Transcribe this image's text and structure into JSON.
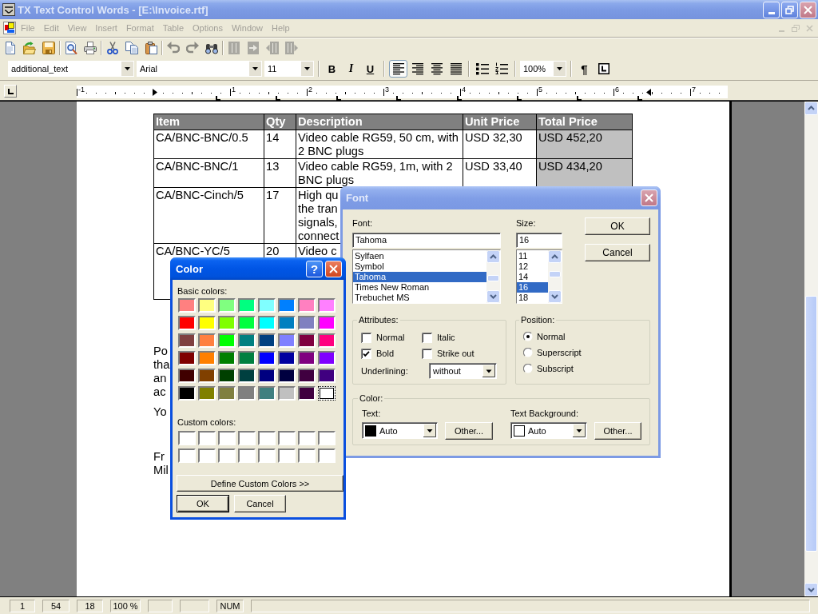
{
  "window": {
    "title": "TX Text Control Words - [E:\\Invoice.rtf]"
  },
  "menu": [
    {
      "label": "File",
      "disabled": true
    },
    {
      "label": "Edit",
      "disabled": true
    },
    {
      "label": "View",
      "disabled": true
    },
    {
      "label": "Insert",
      "disabled": true
    },
    {
      "label": "Format",
      "disabled": true
    },
    {
      "label": "Table",
      "disabled": true
    },
    {
      "label": "Options",
      "disabled": true
    },
    {
      "label": "Window",
      "disabled": true
    },
    {
      "label": "Help",
      "disabled": true
    }
  ],
  "toolbar": [
    {
      "kind": "new",
      "disabled": false
    },
    {
      "kind": "open",
      "disabled": false
    },
    {
      "kind": "save",
      "disabled": false
    },
    {
      "kind": "separator"
    },
    {
      "kind": "preview",
      "disabled": false
    },
    {
      "kind": "print",
      "disabled": false
    },
    {
      "kind": "separator"
    },
    {
      "kind": "cut",
      "disabled": false
    },
    {
      "kind": "copy",
      "disabled": false
    },
    {
      "kind": "paste",
      "disabled": false
    },
    {
      "kind": "separator"
    },
    {
      "kind": "undo",
      "disabled": true
    },
    {
      "kind": "redo",
      "disabled": true
    },
    {
      "kind": "find",
      "disabled": false
    },
    {
      "kind": "separator"
    },
    {
      "kind": "table-cells",
      "disabled": true
    },
    {
      "kind": "table-merge",
      "disabled": true
    },
    {
      "kind": "table-left",
      "disabled": true
    },
    {
      "kind": "table-right",
      "disabled": true
    }
  ],
  "format_bar": {
    "style": "additional_text",
    "font": "Arial",
    "size": "11",
    "text_styles": [
      {
        "kind": "bold",
        "label": "B"
      },
      {
        "kind": "italic",
        "label": "I"
      },
      {
        "kind": "underline",
        "label": "U"
      }
    ],
    "alignments": [
      {
        "kind": "left",
        "selected": true
      },
      {
        "kind": "right",
        "selected": false
      },
      {
        "kind": "center",
        "selected": false
      },
      {
        "kind": "justify",
        "selected": false
      }
    ],
    "lists": [
      {
        "kind": "bullets"
      },
      {
        "kind": "numbering"
      }
    ],
    "zoom": "100%",
    "pilcrow": "¶"
  },
  "ruler": {
    "numbers": [
      "-1",
      "1",
      "2",
      "3",
      "4",
      "5",
      "6",
      "7"
    ]
  },
  "table": {
    "columns": [
      {
        "label": "Item",
        "shaded": false
      },
      {
        "label": "Qty",
        "shaded": false
      },
      {
        "label": "Description",
        "shaded": false
      },
      {
        "label": "Unit Price",
        "shaded": false
      },
      {
        "label": "Total Price",
        "shaded": true
      }
    ],
    "rows": [
      {
        "cells": [
          "CA/BNC-BNC/0.5",
          "14",
          "Video cable RG59, 50 cm, with 2 BNC plugs",
          "USD 32,30",
          "USD 452,20"
        ]
      },
      {
        "cells": [
          "CA/BNC-BNC/1",
          "13",
          "Video cable RG59, 1m, with 2 BNC plugs",
          "USD 33,40",
          "USD 434,20"
        ]
      },
      {
        "cells": [
          "CA/BNC-Cinch/5",
          "17",
          "High qu\nthe tran\nsignals,\nconnect"
        ]
      },
      {
        "cells": [
          "CA/BNC-YC/5",
          "20",
          "Video c"
        ]
      }
    ]
  },
  "paragraphs": [
    "Po\ntha\nan\nac",
    "Yo",
    "Fr\nMil"
  ],
  "color_dialog": {
    "title": "Color",
    "help_button": "?",
    "basic_label": "Basic colors:",
    "basic_colors": [
      {
        "color": "#ff8080",
        "selected": false
      },
      {
        "color": "#ffff80",
        "selected": false
      },
      {
        "color": "#80ff80",
        "selected": false
      },
      {
        "color": "#00ff80",
        "selected": false
      },
      {
        "color": "#80ffff",
        "selected": false
      },
      {
        "color": "#0080ff",
        "selected": false
      },
      {
        "color": "#ff80c0",
        "selected": false
      },
      {
        "color": "#ff80ff",
        "selected": false
      },
      {
        "color": "#ff0000",
        "selected": false
      },
      {
        "color": "#ffff00",
        "selected": false
      },
      {
        "color": "#80ff00",
        "selected": false
      },
      {
        "color": "#00ff40",
        "selected": false
      },
      {
        "color": "#00ffff",
        "selected": false
      },
      {
        "color": "#0080c0",
        "selected": false
      },
      {
        "color": "#8080c0",
        "selected": false
      },
      {
        "color": "#ff00ff",
        "selected": false
      },
      {
        "color": "#804040",
        "selected": false
      },
      {
        "color": "#ff8040",
        "selected": false
      },
      {
        "color": "#00ff00",
        "selected": false
      },
      {
        "color": "#008080",
        "selected": false
      },
      {
        "color": "#004080",
        "selected": false
      },
      {
        "color": "#8080ff",
        "selected": false
      },
      {
        "color": "#800040",
        "selected": false
      },
      {
        "color": "#ff0080",
        "selected": false
      },
      {
        "color": "#800000",
        "selected": false
      },
      {
        "color": "#ff8000",
        "selected": false
      },
      {
        "color": "#008000",
        "selected": false
      },
      {
        "color": "#008040",
        "selected": false
      },
      {
        "color": "#0000ff",
        "selected": false
      },
      {
        "color": "#0000a0",
        "selected": false
      },
      {
        "color": "#800080",
        "selected": false
      },
      {
        "color": "#8000ff",
        "selected": false
      },
      {
        "color": "#400000",
        "selected": false
      },
      {
        "color": "#804000",
        "selected": false
      },
      {
        "color": "#004000",
        "selected": false
      },
      {
        "color": "#004040",
        "selected": false
      },
      {
        "color": "#000080",
        "selected": false
      },
      {
        "color": "#000040",
        "selected": false
      },
      {
        "color": "#400040",
        "selected": false
      },
      {
        "color": "#400080",
        "selected": false
      },
      {
        "color": "#000000",
        "selected": false
      },
      {
        "color": "#808000",
        "selected": false
      },
      {
        "color": "#808040",
        "selected": false
      },
      {
        "color": "#808080",
        "selected": false
      },
      {
        "color": "#408080",
        "selected": false
      },
      {
        "color": "#c0c0c0",
        "selected": false
      },
      {
        "color": "#400040",
        "selected": false
      },
      {
        "color": "#ffffff",
        "selected": true
      }
    ],
    "custom_label": "Custom colors:",
    "custom_colors": [
      {
        "color": "#ffffff"
      },
      {
        "color": "#ffffff"
      },
      {
        "color": "#ffffff"
      },
      {
        "color": "#ffffff"
      },
      {
        "color": "#ffffff"
      },
      {
        "color": "#ffffff"
      },
      {
        "color": "#ffffff"
      },
      {
        "color": "#ffffff"
      },
      {
        "color": "#ffffff"
      },
      {
        "color": "#ffffff"
      },
      {
        "color": "#ffffff"
      },
      {
        "color": "#ffffff"
      },
      {
        "color": "#ffffff"
      },
      {
        "color": "#ffffff"
      },
      {
        "color": "#ffffff"
      },
      {
        "color": "#ffffff"
      }
    ],
    "define_button": "Define Custom Colors >>",
    "ok": "OK",
    "cancel": "Cancel"
  },
  "font_dialog": {
    "title": "Font",
    "font_label": "Font:",
    "font_value": "Tahoma",
    "fonts": [
      {
        "label": "Sylfaen",
        "selected": false
      },
      {
        "label": "Symbol",
        "selected": false
      },
      {
        "label": "Tahoma",
        "selected": true
      },
      {
        "label": "Times New Roman",
        "selected": false
      },
      {
        "label": "Trebuchet MS",
        "selected": false
      }
    ],
    "size_label": "Size:",
    "size_value": "16",
    "sizes": [
      {
        "label": "11",
        "selected": false
      },
      {
        "label": "12",
        "selected": false
      },
      {
        "label": "14",
        "selected": false
      },
      {
        "label": "16",
        "selected": true
      },
      {
        "label": "18",
        "selected": false
      }
    ],
    "ok": "OK",
    "cancel": "Cancel",
    "attributes": {
      "legend": "Attributes:",
      "options": [
        {
          "label": "Normal",
          "checked": false
        },
        {
          "label": "Italic",
          "checked": false
        },
        {
          "label": "Bold",
          "checked": true
        },
        {
          "label": "Strike out",
          "checked": false
        }
      ],
      "underline_label": "Underlining:",
      "underline_value": "without"
    },
    "position": {
      "legend": "Position:",
      "options": [
        {
          "label": "Normal",
          "selected": true
        },
        {
          "label": "Superscript",
          "selected": false
        },
        {
          "label": "Subscript",
          "selected": false
        }
      ]
    },
    "color": {
      "legend": "Color:",
      "fields": [
        {
          "label": "Text:",
          "value": "Auto",
          "color": "#000000",
          "button": "Other..."
        },
        {
          "label": "Text Background:",
          "value": "Auto",
          "color": "#ffffff",
          "button": "Other..."
        }
      ]
    }
  },
  "status_bar": {
    "panes": [
      {
        "kind": "text",
        "text": "1"
      },
      {
        "kind": "text",
        "text": "54"
      },
      {
        "kind": "text",
        "text": "18"
      },
      {
        "kind": "text",
        "text": "100 %"
      },
      {
        "kind": "empty"
      },
      {
        "kind": "empty"
      },
      {
        "kind": "text",
        "text": "NUM"
      },
      {
        "kind": "empty"
      }
    ]
  }
}
